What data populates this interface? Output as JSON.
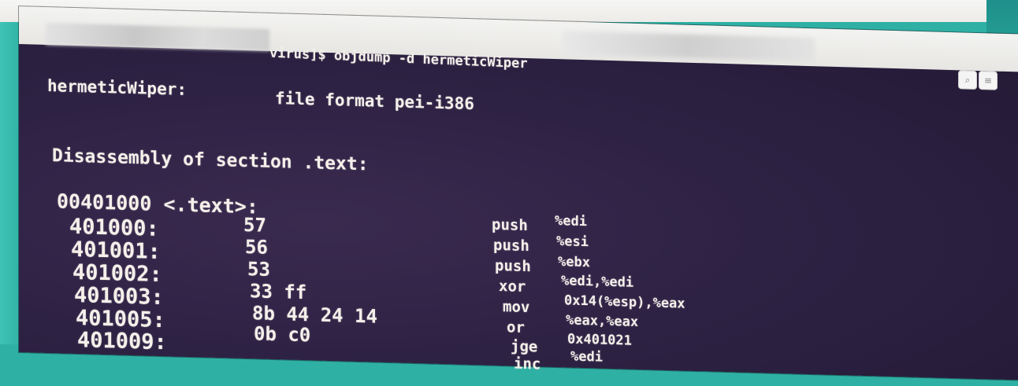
{
  "terminal": {
    "prompt_line": "virus]$ objdump -d hermeticWiper",
    "file_label": "hermeticWiper:",
    "file_format": "file format pei-i386",
    "section_heading": "Disassembly of section .text:",
    "symbol_line": "00401000 <.text>:",
    "instructions": [
      {
        "address": "401000:",
        "bytes": "57",
        "mnemonic": "push",
        "operands": "%edi"
      },
      {
        "address": "401001:",
        "bytes": "56",
        "mnemonic": "push",
        "operands": "%esi"
      },
      {
        "address": "401002:",
        "bytes": "53",
        "mnemonic": "push",
        "operands": "%ebx"
      },
      {
        "address": "401003:",
        "bytes": "33 ff",
        "mnemonic": "xor",
        "operands": "%edi,%edi"
      },
      {
        "address": "401005:",
        "bytes": "8b 44 24 14",
        "mnemonic": "mov",
        "operands": "0x14(%esp),%eax"
      },
      {
        "address": "401009:",
        "bytes": "0b c0",
        "mnemonic": "or",
        "operands": "%eax,%eax"
      },
      {
        "address": "",
        "bytes": "",
        "mnemonic": "jge",
        "operands": "0x401021"
      },
      {
        "address": "",
        "bytes": "",
        "mnemonic": "inc",
        "operands": "%edi"
      }
    ]
  },
  "titlebar": {
    "search_icon": "search-icon",
    "menu_icon": "hamburger-menu-icon"
  }
}
